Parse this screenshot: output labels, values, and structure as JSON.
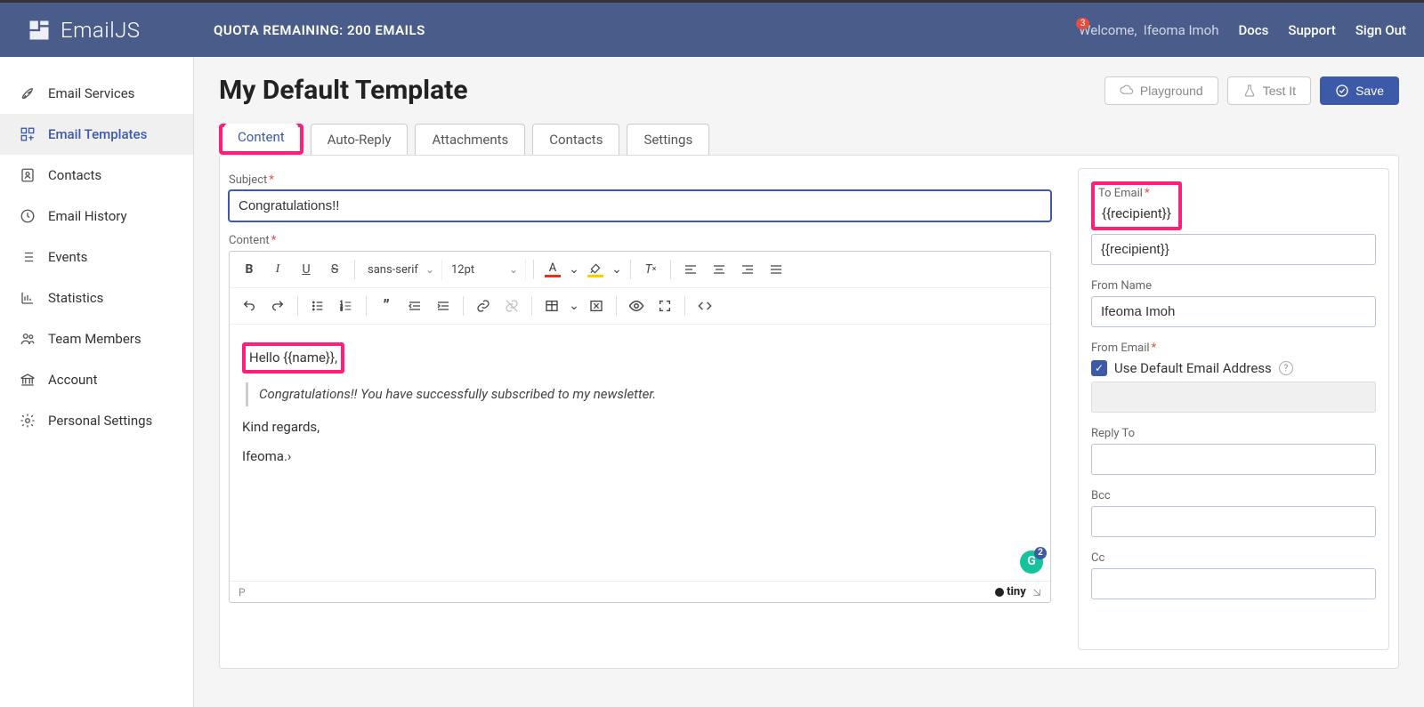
{
  "topbar": {
    "logo_text": "EmailJS",
    "quota": "QUOTA REMAINING: 200 EMAILS",
    "notif_count": "3",
    "welcome_prefix": "Welcome,",
    "welcome_name": "Ifeoma Imoh",
    "links": {
      "docs": "Docs",
      "support": "Support",
      "signout": "Sign Out"
    }
  },
  "sidebar": {
    "items": [
      {
        "label": "Email Services"
      },
      {
        "label": "Email Templates"
      },
      {
        "label": "Contacts"
      },
      {
        "label": "Email History"
      },
      {
        "label": "Events"
      },
      {
        "label": "Statistics"
      },
      {
        "label": "Team Members"
      },
      {
        "label": "Account"
      },
      {
        "label": "Personal Settings"
      }
    ]
  },
  "page": {
    "title": "My Default Template",
    "actions": {
      "playground": "Playground",
      "testit": "Test It",
      "save": "Save"
    }
  },
  "tabs": {
    "content": "Content",
    "autoreply": "Auto-Reply",
    "attachments": "Attachments",
    "contacts": "Contacts",
    "settings": "Settings"
  },
  "editor": {
    "subject_label": "Subject",
    "subject_value": "Congratulations!!",
    "content_label": "Content",
    "font_family": "sans-serif",
    "font_size": "12pt",
    "body_hello": "Hello {{name}},",
    "body_quote": "Congratulations!! You have successfully subscribed to my newsletter.",
    "body_regards": "Kind regards,",
    "body_signature": "Ifeoma.›",
    "footer_path": "P",
    "footer_brand": "tiny",
    "grammarly_count": "2"
  },
  "right": {
    "to_label": "To Email",
    "to_value": "{{recipient}}",
    "from_name_label": "From Name",
    "from_name_value": "Ifeoma Imoh",
    "from_email_label": "From Email",
    "use_default": "Use Default Email Address",
    "reply_to_label": "Reply To",
    "bcc_label": "Bcc",
    "cc_label": "Cc"
  }
}
